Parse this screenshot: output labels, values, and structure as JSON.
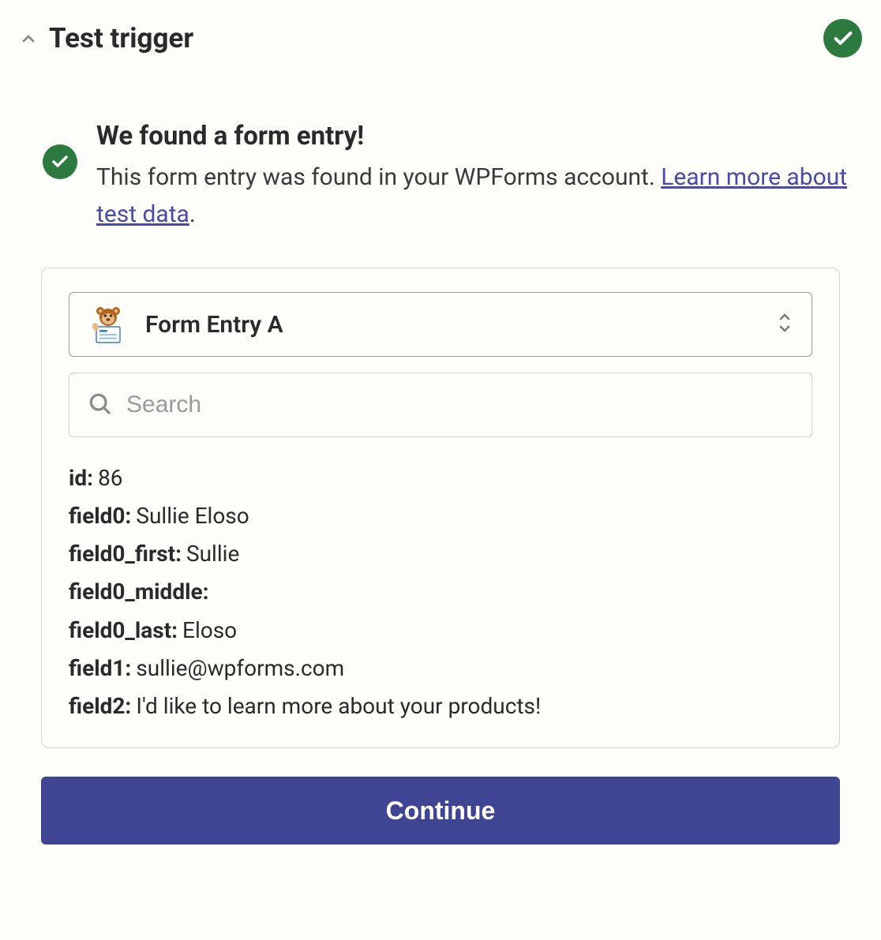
{
  "header": {
    "title": "Test trigger"
  },
  "message": {
    "title": "We found a form entry!",
    "body_before_link": "This form entry was found in your WPForms account. ",
    "link_text": "Learn more about test data",
    "body_after_link": "."
  },
  "selector": {
    "selected": "Form Entry A",
    "app_icon": "wpforms-app-icon"
  },
  "search": {
    "placeholder": "Search",
    "value": ""
  },
  "fields": [
    {
      "key": "id:",
      "value": "86"
    },
    {
      "key": "field0:",
      "value": "Sullie Eloso"
    },
    {
      "key": "field0_first:",
      "value": "Sullie"
    },
    {
      "key": "field0_middle:",
      "value": ""
    },
    {
      "key": "field0_last:",
      "value": "Eloso"
    },
    {
      "key": "field1:",
      "value": "sullie@wpforms.com"
    },
    {
      "key": "field2:",
      "value": "I'd like to learn more about your products!"
    }
  ],
  "continue_label": "Continue",
  "colors": {
    "success_badge": "#2c7a3f",
    "link": "#4a4ba8",
    "primary_button": "#3f4592"
  }
}
